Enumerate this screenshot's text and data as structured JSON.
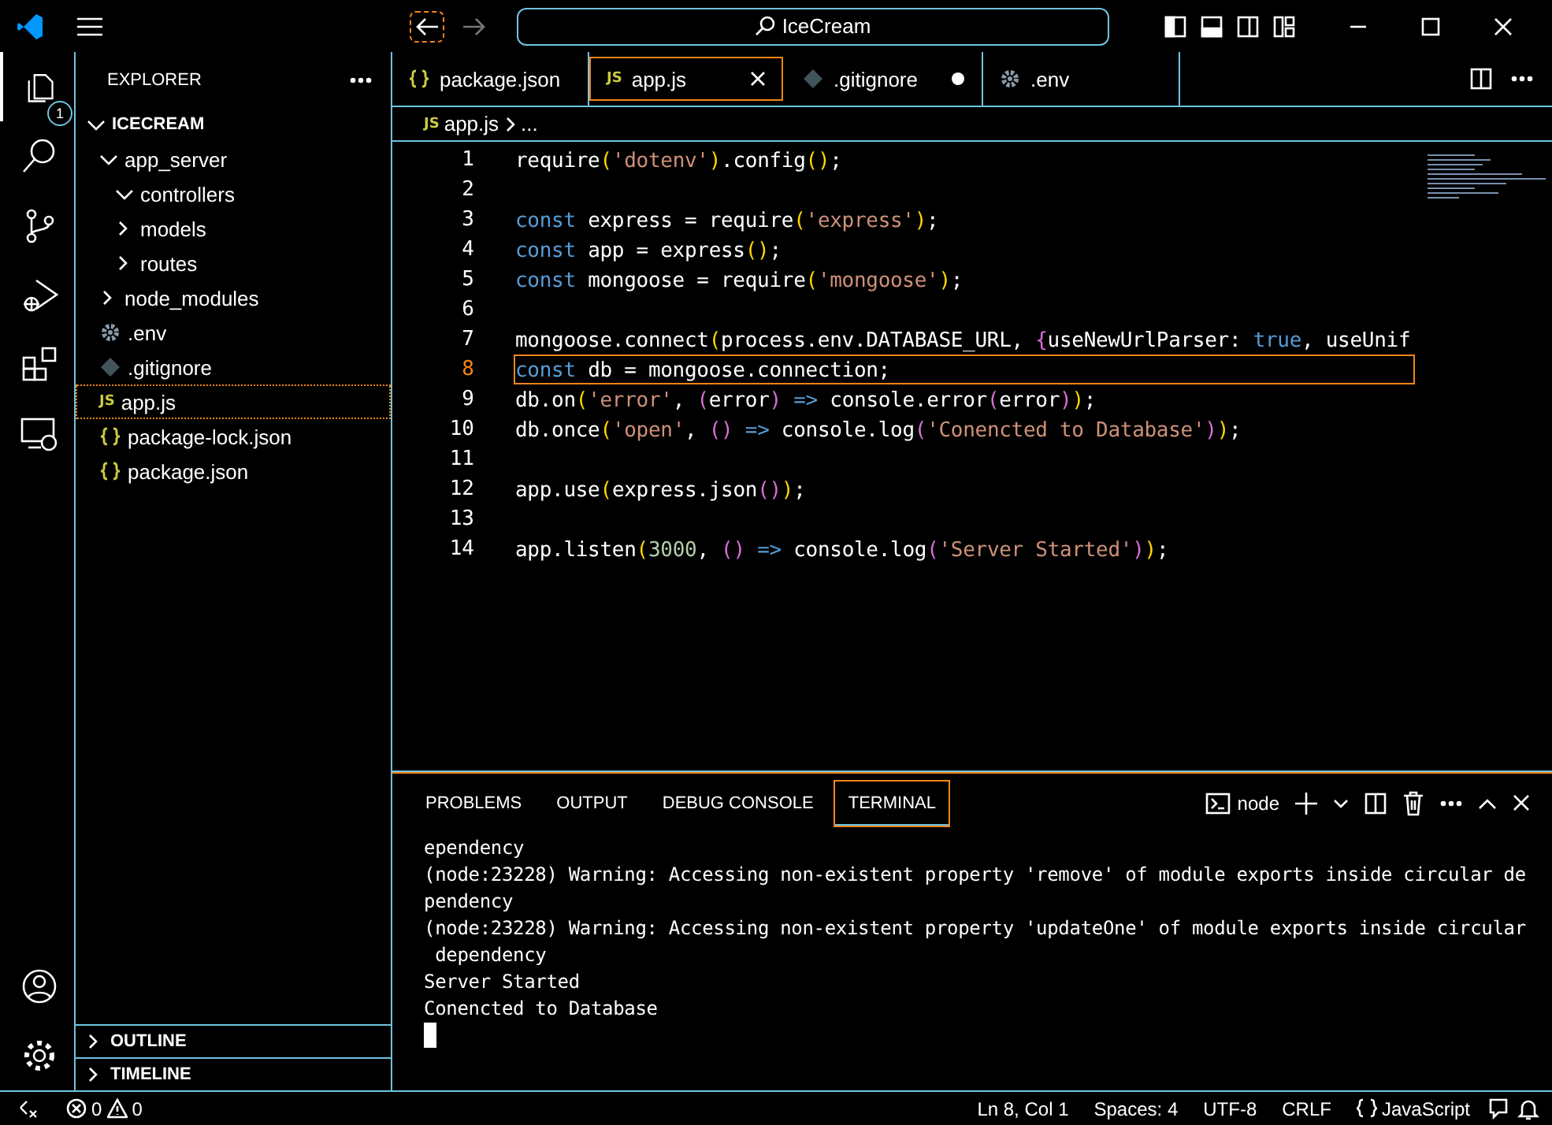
{
  "title_bar": {
    "search": "IceCream"
  },
  "activity_bar": {
    "items": [
      {
        "kind": "explorer",
        "badge": "1",
        "selected": true
      },
      {
        "kind": "search",
        "selected": false
      },
      {
        "kind": "source-control",
        "selected": false
      },
      {
        "kind": "run-debug",
        "selected": false
      },
      {
        "kind": "extensions",
        "selected": false
      },
      {
        "kind": "remote",
        "selected": false
      }
    ],
    "bottom": [
      {
        "kind": "account"
      },
      {
        "kind": "settings"
      }
    ]
  },
  "sidebar": {
    "title": "EXPLORER",
    "root": {
      "label": "ICECREAM",
      "expanded": true,
      "children": [
        {
          "label": "app_server",
          "kind": "folder",
          "expanded": true,
          "selected": false,
          "children": [
            {
              "label": "controllers",
              "kind": "folder",
              "expanded": true,
              "selected": false
            },
            {
              "label": "models",
              "kind": "folder",
              "expanded": false,
              "selected": false
            },
            {
              "label": "routes",
              "kind": "folder",
              "expanded": false,
              "selected": false
            }
          ]
        },
        {
          "label": "node_modules",
          "kind": "folder",
          "expanded": false,
          "selected": false
        },
        {
          "label": ".env",
          "kind": "env",
          "selected": false
        },
        {
          "label": ".gitignore",
          "kind": "git",
          "selected": false
        },
        {
          "label": "app.js",
          "kind": "js",
          "icon_text": "JS",
          "selected": true
        },
        {
          "label": "package-lock.json",
          "kind": "json",
          "selected": false
        },
        {
          "label": "package.json",
          "kind": "json",
          "selected": false
        }
      ]
    },
    "sections": [
      {
        "label": "OUTLINE",
        "expanded": false
      },
      {
        "label": "TIMELINE",
        "expanded": false
      }
    ]
  },
  "tabs": [
    {
      "label": "package.json",
      "kind": "json",
      "selected": false,
      "modified": false
    },
    {
      "label": "app.js",
      "kind": "js",
      "icon_text": "JS",
      "selected": true,
      "modified": false
    },
    {
      "label": ".gitignore",
      "kind": "git",
      "selected": false,
      "modified": true
    },
    {
      "label": ".env",
      "kind": "env",
      "selected": false,
      "modified": false
    }
  ],
  "breadcrumb": {
    "icon_text": "JS",
    "file": "app.js",
    "symbol": "..."
  },
  "editor": {
    "lines": [
      {
        "number": "1",
        "current": false,
        "tokens": [
          {
            "kind": "plain",
            "text": "require"
          },
          {
            "kind": "b1",
            "text": "("
          },
          {
            "kind": "str",
            "text": "'dotenv'"
          },
          {
            "kind": "b1",
            "text": ")"
          },
          {
            "kind": "plain",
            "text": ".config"
          },
          {
            "kind": "b1",
            "text": "()"
          },
          {
            "kind": "plain",
            "text": ";"
          }
        ]
      },
      {
        "number": "2",
        "current": false
      },
      {
        "number": "3",
        "current": false,
        "tokens": [
          {
            "kind": "kw",
            "text": "const"
          },
          {
            "kind": "plain",
            "text": " express = require"
          },
          {
            "kind": "b1",
            "text": "("
          },
          {
            "kind": "str",
            "text": "'express'"
          },
          {
            "kind": "b1",
            "text": ")"
          },
          {
            "kind": "plain",
            "text": ";"
          }
        ]
      },
      {
        "number": "4",
        "current": false,
        "tokens": [
          {
            "kind": "kw",
            "text": "const"
          },
          {
            "kind": "plain",
            "text": " app = express"
          },
          {
            "kind": "b1",
            "text": "()"
          },
          {
            "kind": "plain",
            "text": ";"
          }
        ]
      },
      {
        "number": "5",
        "current": false,
        "tokens": [
          {
            "kind": "kw",
            "text": "const"
          },
          {
            "kind": "plain",
            "text": " mongoose = require"
          },
          {
            "kind": "b1",
            "text": "("
          },
          {
            "kind": "str",
            "text": "'mongoose'"
          },
          {
            "kind": "b1",
            "text": ")"
          },
          {
            "kind": "plain",
            "text": ";"
          }
        ]
      },
      {
        "number": "6",
        "current": false
      },
      {
        "number": "7",
        "current": false,
        "tokens": [
          {
            "kind": "plain",
            "text": "mongoose.connect"
          },
          {
            "kind": "b1",
            "text": "("
          },
          {
            "kind": "plain",
            "text": "process.env.DATABASE_URL, "
          },
          {
            "kind": "b2",
            "text": "{"
          },
          {
            "kind": "plain",
            "text": "useNewUrlParser: "
          },
          {
            "kind": "kw",
            "text": "true"
          },
          {
            "kind": "plain",
            "text": ", useUnif"
          }
        ]
      },
      {
        "number": "8",
        "current": true,
        "tokens": [
          {
            "kind": "kw",
            "text": "const"
          },
          {
            "kind": "plain",
            "text": " db = mongoose.connection;"
          }
        ]
      },
      {
        "number": "9",
        "current": false,
        "tokens": [
          {
            "kind": "plain",
            "text": "db.on"
          },
          {
            "kind": "b1",
            "text": "("
          },
          {
            "kind": "str",
            "text": "'error'"
          },
          {
            "kind": "plain",
            "text": ", "
          },
          {
            "kind": "b2",
            "text": "("
          },
          {
            "kind": "plain",
            "text": "error"
          },
          {
            "kind": "b2",
            "text": ")"
          },
          {
            "kind": "kw",
            "text": " =>"
          },
          {
            "kind": "plain",
            "text": " console.error"
          },
          {
            "kind": "b2",
            "text": "("
          },
          {
            "kind": "plain",
            "text": "error"
          },
          {
            "kind": "b2",
            "text": ")"
          },
          {
            "kind": "b1",
            "text": ")"
          },
          {
            "kind": "plain",
            "text": ";"
          }
        ]
      },
      {
        "number": "10",
        "current": false,
        "tokens": [
          {
            "kind": "plain",
            "text": "db.once"
          },
          {
            "kind": "b1",
            "text": "("
          },
          {
            "kind": "str",
            "text": "'open'"
          },
          {
            "kind": "plain",
            "text": ", "
          },
          {
            "kind": "b2",
            "text": "()"
          },
          {
            "kind": "kw",
            "text": " =>"
          },
          {
            "kind": "plain",
            "text": " console.log"
          },
          {
            "kind": "b2",
            "text": "("
          },
          {
            "kind": "str",
            "text": "'Conencted to Database'"
          },
          {
            "kind": "b2",
            "text": ")"
          },
          {
            "kind": "b1",
            "text": ")"
          },
          {
            "kind": "plain",
            "text": ";"
          }
        ]
      },
      {
        "number": "11",
        "current": false
      },
      {
        "number": "12",
        "current": false,
        "tokens": [
          {
            "kind": "plain",
            "text": "app.use"
          },
          {
            "kind": "b1",
            "text": "("
          },
          {
            "kind": "plain",
            "text": "express.json"
          },
          {
            "kind": "b2",
            "text": "()"
          },
          {
            "kind": "b1",
            "text": ")"
          },
          {
            "kind": "plain",
            "text": ";"
          }
        ]
      },
      {
        "number": "13",
        "current": false
      },
      {
        "number": "14",
        "current": false,
        "tokens": [
          {
            "kind": "plain",
            "text": "app.listen"
          },
          {
            "kind": "b1",
            "text": "("
          },
          {
            "kind": "num",
            "text": "3000"
          },
          {
            "kind": "plain",
            "text": ", "
          },
          {
            "kind": "b2",
            "text": "()"
          },
          {
            "kind": "kw",
            "text": " =>"
          },
          {
            "kind": "plain",
            "text": " console.log"
          },
          {
            "kind": "b2",
            "text": "("
          },
          {
            "kind": "str",
            "text": "'Server Started'"
          },
          {
            "kind": "b2",
            "text": ")"
          },
          {
            "kind": "b1",
            "text": ")"
          },
          {
            "kind": "plain",
            "text": ";"
          }
        ]
      }
    ]
  },
  "panel": {
    "tabs": [
      {
        "label": "PROBLEMS",
        "selected": false
      },
      {
        "label": "OUTPUT",
        "selected": false
      },
      {
        "label": "DEBUG CONSOLE",
        "selected": false
      },
      {
        "label": "TERMINAL",
        "selected": true
      }
    ],
    "shell": "node",
    "terminal_lines": [
      "ependency",
      "(node:23228) Warning: Accessing non-existent property 'remove' of module exports inside circular de",
      "pendency",
      "(node:23228) Warning: Accessing non-existent property 'updateOne' of module exports inside circular",
      " dependency",
      "Server Started",
      "Conencted to Database"
    ]
  },
  "status_bar": {
    "errors": "0",
    "warnings": "0",
    "position": "Ln 8, Col 1",
    "spaces": "Spaces: 4",
    "encoding": "UTF-8",
    "eol": "CRLF",
    "language": "JavaScript"
  }
}
